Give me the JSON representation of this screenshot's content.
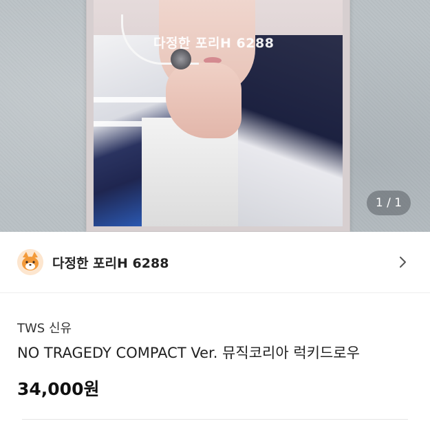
{
  "photo": {
    "watermark": "다정한 포리H 6288",
    "pager": "1 / 1"
  },
  "seller": {
    "name": "다정한 포리H 6288",
    "avatar_icon": "fox-avatar-icon",
    "chevron_icon": "chevron-right-icon"
  },
  "product": {
    "brand": "TWS 신유",
    "title": "NO TRAGEDY COMPACT Ver. 뮤직코리아 럭키드로우",
    "price": "34,000원"
  },
  "colors": {
    "background": "#ffffff",
    "text_primary": "#222222",
    "divider": "#eeeeee"
  }
}
